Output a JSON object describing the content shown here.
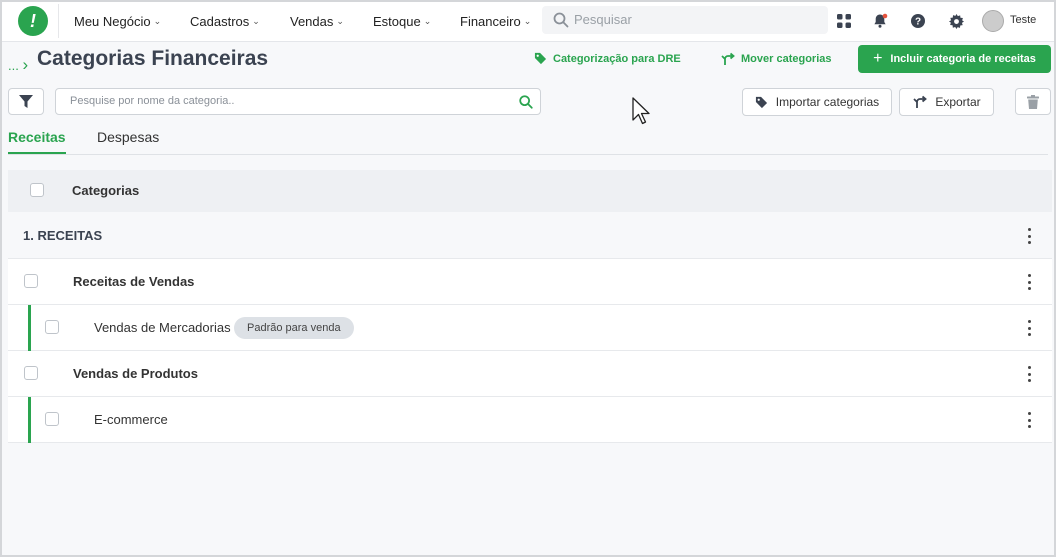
{
  "nav": {
    "logo_glyph": "!",
    "menus": [
      {
        "label": "Meu Negócio"
      },
      {
        "label": "Cadastros"
      },
      {
        "label": "Vendas"
      },
      {
        "label": "Estoque"
      },
      {
        "label": "Financeiro"
      }
    ],
    "search_placeholder": "Pesquisar",
    "user_name": "Teste",
    "accent": "#2aa44f",
    "icons": [
      "apps-icon",
      "bell-icon",
      "help-icon",
      "gear-icon"
    ]
  },
  "header": {
    "breadcrumb": "...",
    "title": "Categorias Financeiras",
    "link_dre": "Categorização para DRE",
    "link_move": "Mover categorias",
    "primary_button": "Incluir categoria de receitas"
  },
  "toolbar": {
    "search_placeholder": "Pesquise por nome da categoria..",
    "import_label": "Importar categorias",
    "export_label": "Exportar"
  },
  "tabs": [
    {
      "label": "Receitas",
      "active": true
    },
    {
      "label": "Despesas",
      "active": false
    }
  ],
  "table": {
    "header": "Categorias",
    "rows": [
      {
        "label": "1. RECEITAS",
        "level": 0
      },
      {
        "label": "Receitas de Vendas",
        "level": 1
      },
      {
        "label": "Vendas de Mercadorias",
        "level": 2,
        "badge": "Padrão para venda"
      },
      {
        "label": "Vendas de Produtos",
        "level": 1
      },
      {
        "label": "E-commerce",
        "level": 2
      }
    ]
  }
}
